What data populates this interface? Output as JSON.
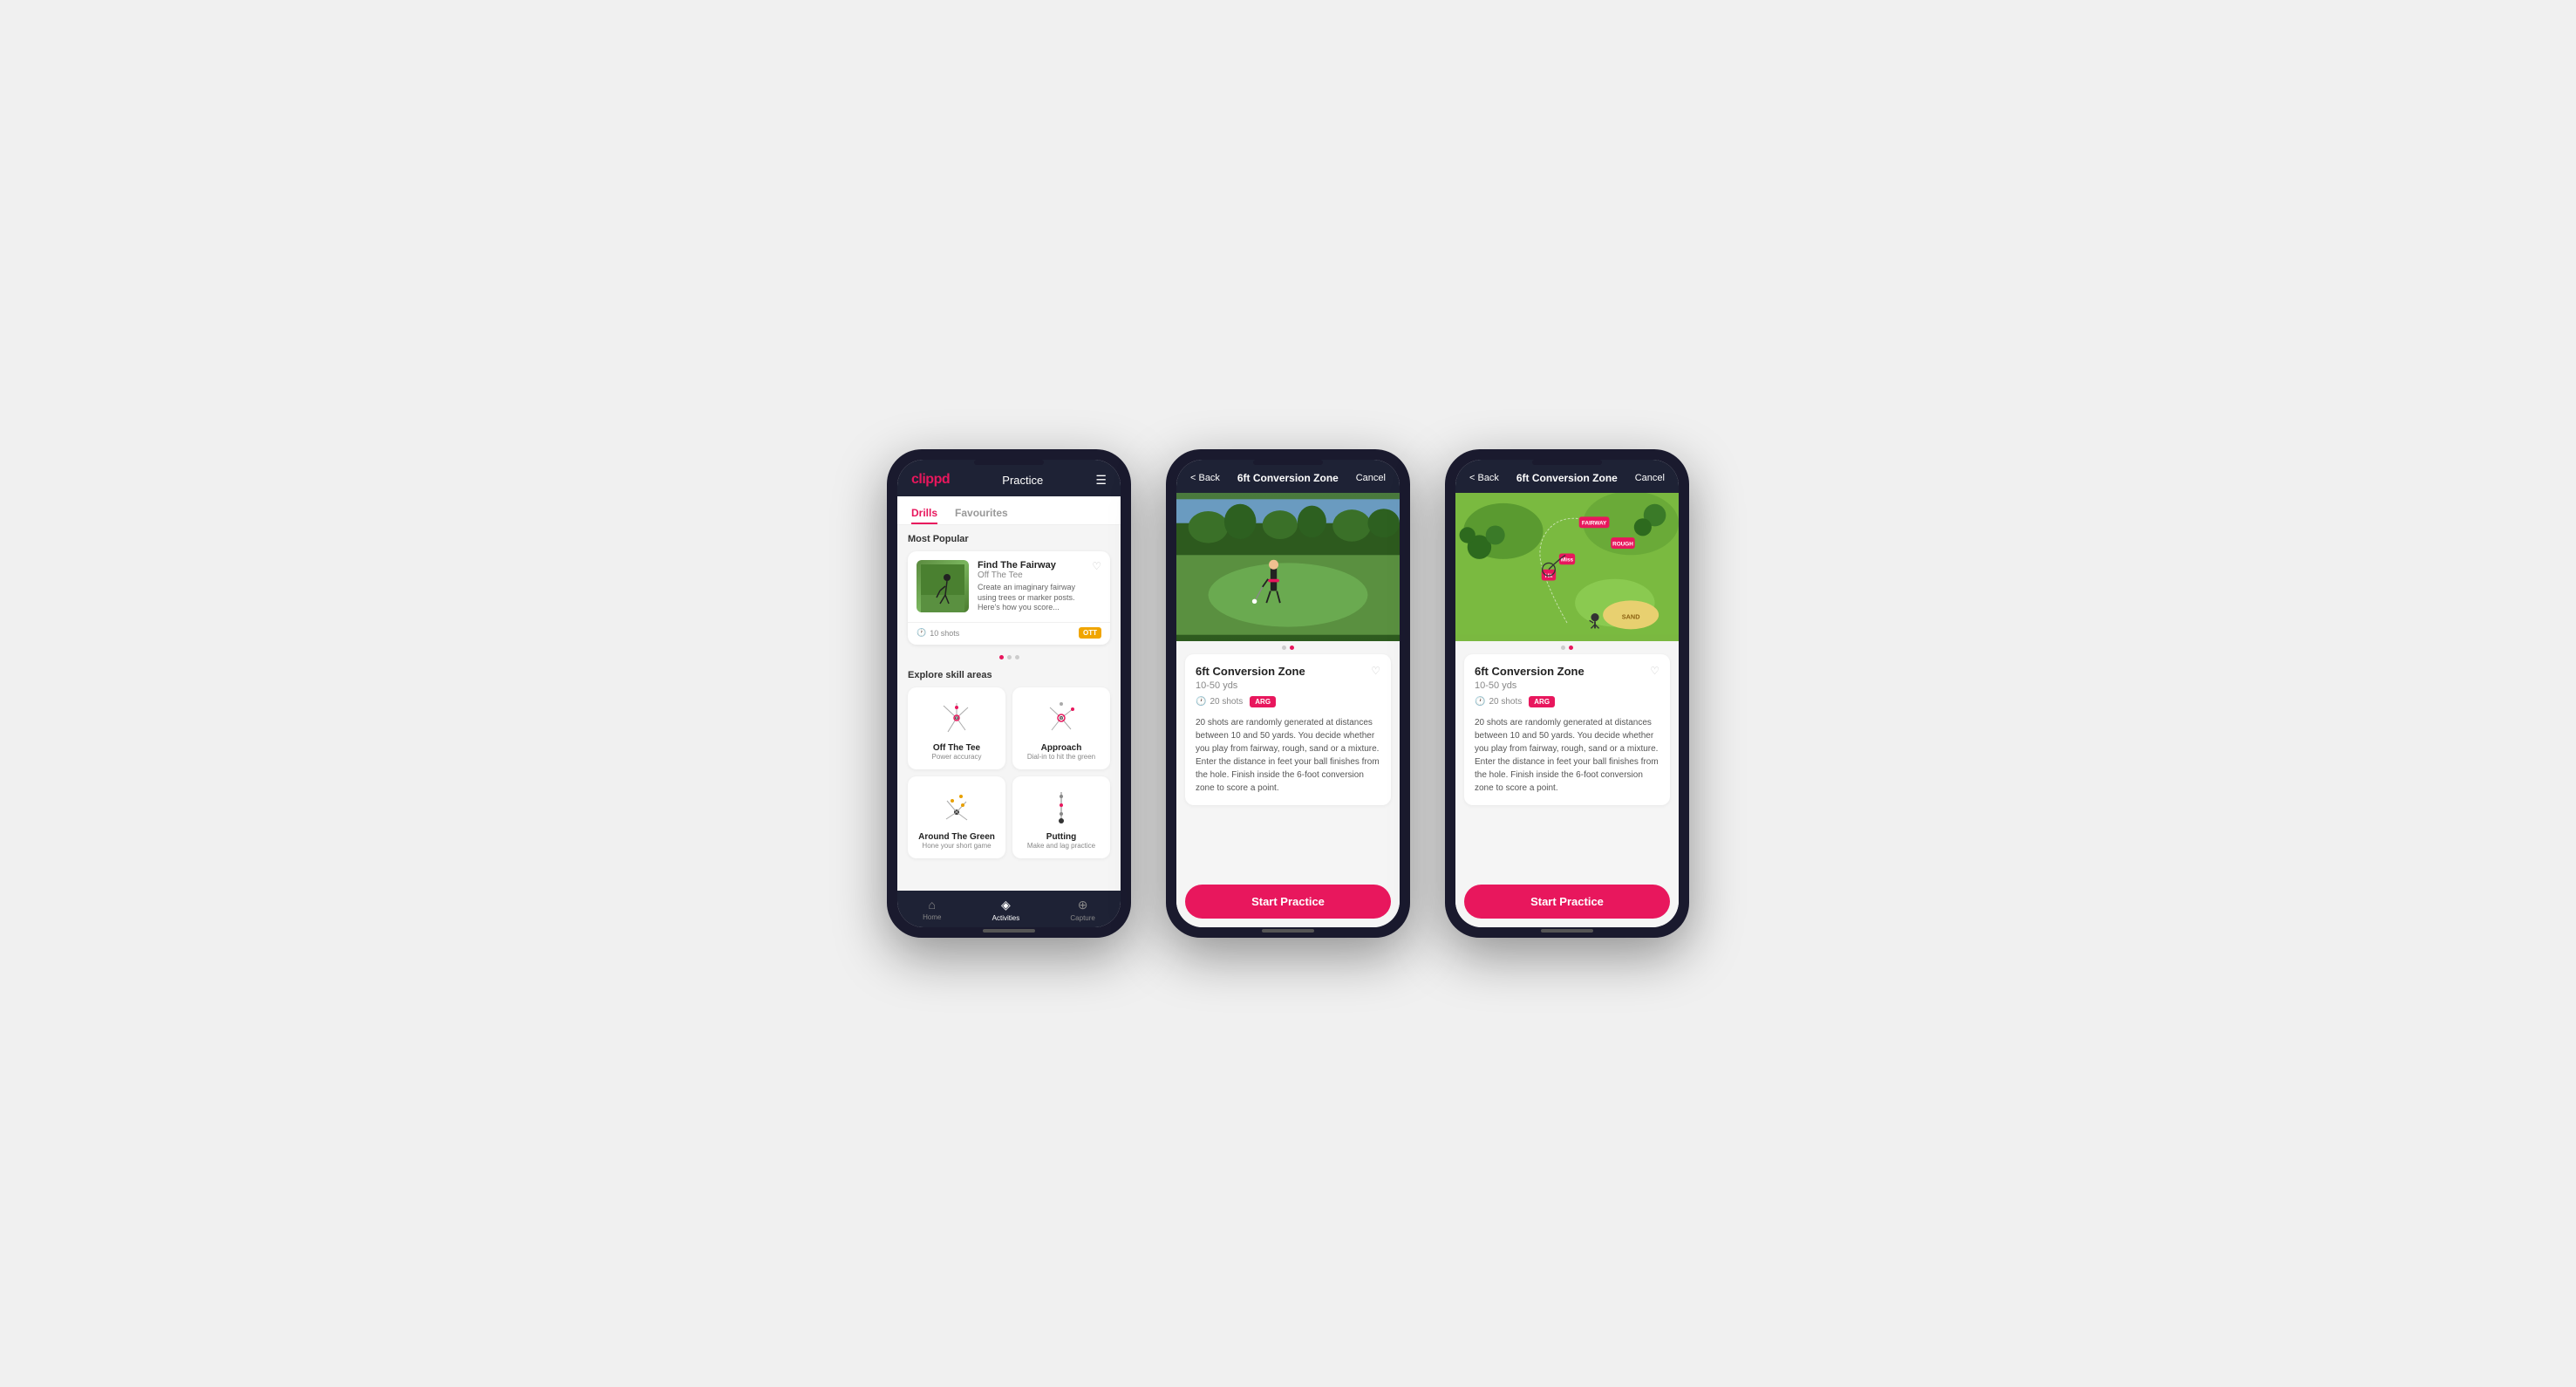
{
  "phone1": {
    "header": {
      "logo": "clippd",
      "title": "Practice",
      "menu_icon": "☰"
    },
    "tabs": [
      {
        "label": "Drills",
        "active": true
      },
      {
        "label": "Favourites",
        "active": false
      }
    ],
    "most_popular_label": "Most Popular",
    "featured_drill": {
      "name": "Find The Fairway",
      "category": "Off The Tee",
      "description": "Create an imaginary fairway using trees or marker posts. Here's how you score...",
      "shots": "10 shots",
      "tag": "OTT",
      "fav_icon": "♡"
    },
    "dots": [
      "active",
      "inactive",
      "inactive"
    ],
    "explore_label": "Explore skill areas",
    "skill_areas": [
      {
        "name": "Off The Tee",
        "desc": "Power accuracy"
      },
      {
        "name": "Approach",
        "desc": "Dial-in to hit the green"
      },
      {
        "name": "Around The Green",
        "desc": "Hone your short game"
      },
      {
        "name": "Putting",
        "desc": "Make and lag practice"
      }
    ],
    "nav": [
      {
        "label": "Home",
        "icon": "⌂",
        "active": false
      },
      {
        "label": "Activities",
        "icon": "◈",
        "active": true
      },
      {
        "label": "Capture",
        "icon": "⊕",
        "active": false
      }
    ]
  },
  "phone2": {
    "header": {
      "back_label": "< Back",
      "title": "6ft Conversion Zone",
      "cancel_label": "Cancel"
    },
    "drill": {
      "name": "6ft Conversion Zone",
      "range": "10-50 yds",
      "shots": "20 shots",
      "tag": "ARG",
      "fav_icon": "♡",
      "description": "20 shots are randomly generated at distances between 10 and 50 yards. You decide whether you play from fairway, rough, sand or a mixture. Enter the distance in feet your ball finishes from the hole. Finish inside the 6-foot conversion zone to score a point.",
      "start_btn": "Start Practice"
    },
    "dots": [
      "inactive",
      "active"
    ],
    "hero_type": "photo"
  },
  "phone3": {
    "header": {
      "back_label": "< Back",
      "title": "6ft Conversion Zone",
      "cancel_label": "Cancel"
    },
    "drill": {
      "name": "6ft Conversion Zone",
      "range": "10-50 yds",
      "shots": "20 shots",
      "tag": "ARG",
      "fav_icon": "♡",
      "description": "20 shots are randomly generated at distances between 10 and 50 yards. You decide whether you play from fairway, rough, sand or a mixture. Enter the distance in feet your ball finishes from the hole. Finish inside the 6-foot conversion zone to score a point.",
      "start_btn": "Start Practice"
    },
    "dots": [
      "inactive",
      "active"
    ],
    "hero_type": "map"
  }
}
